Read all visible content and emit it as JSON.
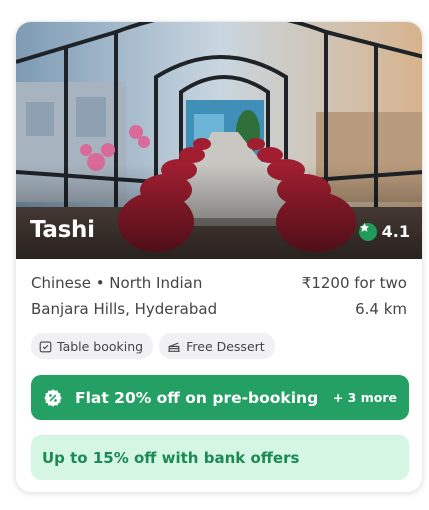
{
  "restaurant": {
    "name": "Tashi",
    "rating": "4.1",
    "cuisines": "Chinese • North Indian",
    "price": "₹1200 for two",
    "location": "Banjara Hills, Hyderabad",
    "distance": "6.4 km"
  },
  "features": [
    {
      "icon": "calendar-check-icon",
      "label": "Table booking"
    },
    {
      "icon": "cake-icon",
      "label": "Free Dessert"
    }
  ],
  "offers": {
    "primary": "Flat 20% off on pre-booking",
    "more": "+ 3 more",
    "bank": "Up to 15% off with bank offers"
  },
  "colors": {
    "offer_green": "#24a065",
    "bank_offer_bg": "#d4f6e3",
    "bank_offer_text": "#1c8a55",
    "rating_star_bg": "#1f9c5a"
  }
}
